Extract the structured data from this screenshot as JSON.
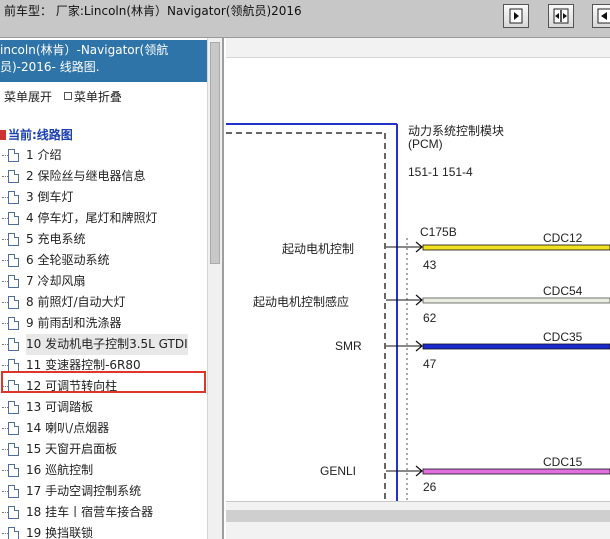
{
  "top_bar": {
    "current_model": "前车型：  厂家:Lincoln(林肯）Navigator(领航员)2016",
    "buttons": [
      {
        "name": "expand-right-button"
      },
      {
        "name": "split-view-button"
      },
      {
        "name": "collapse-left-button"
      }
    ]
  },
  "left_panel": {
    "header_line1": "incoln(林肯）-Navigator(领航",
    "header_line2": "员)-2016- 线路图.",
    "expand_label": "菜单展开",
    "collapse_label": "菜单折叠",
    "current_label": "当前:线路图",
    "items": [
      {
        "label": "1 介绍"
      },
      {
        "label": "2 保险丝与继电器信息"
      },
      {
        "label": "3 倒车灯"
      },
      {
        "label": "4 停车灯，尾灯和牌照灯"
      },
      {
        "label": "5 充电系统"
      },
      {
        "label": "6 全轮驱动系统"
      },
      {
        "label": "7 冷却风扇"
      },
      {
        "label": "8 前照灯/自动大灯"
      },
      {
        "label": "9 前雨刮和洗涤器"
      },
      {
        "label": "10 发动机电子控制3.5L GTDI",
        "selected": true
      },
      {
        "label": "11 变速器控制-6R80"
      },
      {
        "label": "12 可调节转向柱"
      },
      {
        "label": "13 可调踏板"
      },
      {
        "label": "14 喇叭/点烟器"
      },
      {
        "label": "15 天窗开启面板"
      },
      {
        "label": "16 巡航控制"
      },
      {
        "label": "17 手动空调控制系统"
      },
      {
        "label": "18 挂车丨宿营车接合器"
      },
      {
        "label": "19 换挡联锁"
      }
    ]
  },
  "diagram": {
    "module_title": "动力系统控制模块",
    "module_abbr": "(PCM)",
    "refs": "151-1   151-4",
    "connector": "C175B",
    "signals": [
      {
        "label": "起动电机控制",
        "pin": "43",
        "circuit": "CDC12",
        "color": "#f0e020"
      },
      {
        "label": "起动电机控制感应",
        "pin": "62",
        "circuit": "CDC54",
        "color": "#e8ede0"
      },
      {
        "label": "SMR",
        "pin": "47",
        "circuit": "CDC35",
        "color": "#1a2ad0"
      },
      {
        "label": "GENLI",
        "pin": "26",
        "circuit": "CDC15",
        "color": "#e070e0"
      }
    ]
  },
  "colors": {
    "header_bg": "#2f74a8",
    "selection_border": "#e0352b",
    "module_border": "#2233cc"
  }
}
